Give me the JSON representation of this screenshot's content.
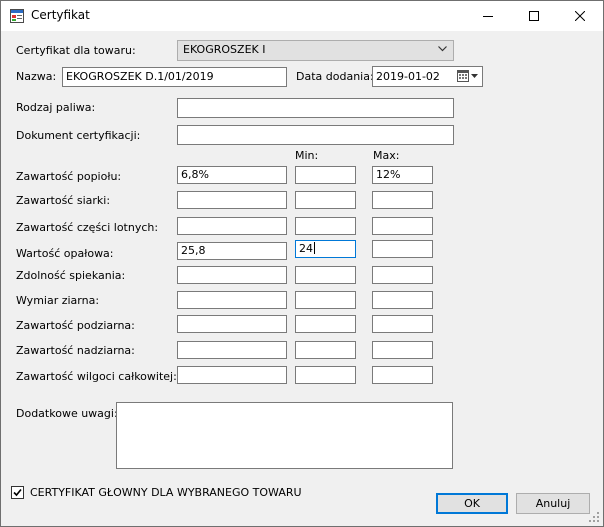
{
  "window": {
    "title": "Certyfikat"
  },
  "product": {
    "label": "Certyfikat dla towaru:",
    "selected": "EKOGROSZEK I"
  },
  "name": {
    "label": "Nazwa:",
    "value": "EKOGROSZEK D.1/01/2019"
  },
  "date_added": {
    "label": "Data dodania:",
    "value": "2019-01-02"
  },
  "fuel_type": {
    "label": "Rodzaj paliwa:",
    "value": ""
  },
  "certification_doc": {
    "label": "Dokument certyfikacji:",
    "value": ""
  },
  "columns": {
    "min": "Min:",
    "max": "Max:"
  },
  "params": [
    {
      "label": "Zawartość popiołu:",
      "value": "6,8%",
      "min": "",
      "max": "12%"
    },
    {
      "label": "Zawartość siarki:",
      "value": "",
      "min": "",
      "max": ""
    },
    {
      "label": "Zawartość części lotnych:",
      "value": "",
      "min": "",
      "max": ""
    },
    {
      "label": "Wartość opałowa:",
      "value": "25,8",
      "min": "24",
      "max": ""
    },
    {
      "label": "Zdolność spiekania:",
      "value": "",
      "min": "",
      "max": ""
    },
    {
      "label": "Wymiar ziarna:",
      "value": "",
      "min": "",
      "max": ""
    },
    {
      "label": "Zawartość podziarna:",
      "value": "",
      "min": "",
      "max": ""
    },
    {
      "label": "Zawartość nadziarna:",
      "value": "",
      "min": "",
      "max": ""
    },
    {
      "label": "Zawartość wilgoci całkowitej:",
      "value": "",
      "min": "",
      "max": ""
    }
  ],
  "notes": {
    "label": "Dodatkowe uwagi:",
    "value": ""
  },
  "main_cert": {
    "label": "CERTYFIKAT GŁOWNY DLA WYBRANEGO TOWARU",
    "checked": true
  },
  "buttons": {
    "ok": "OK",
    "cancel": "Anuluj"
  }
}
